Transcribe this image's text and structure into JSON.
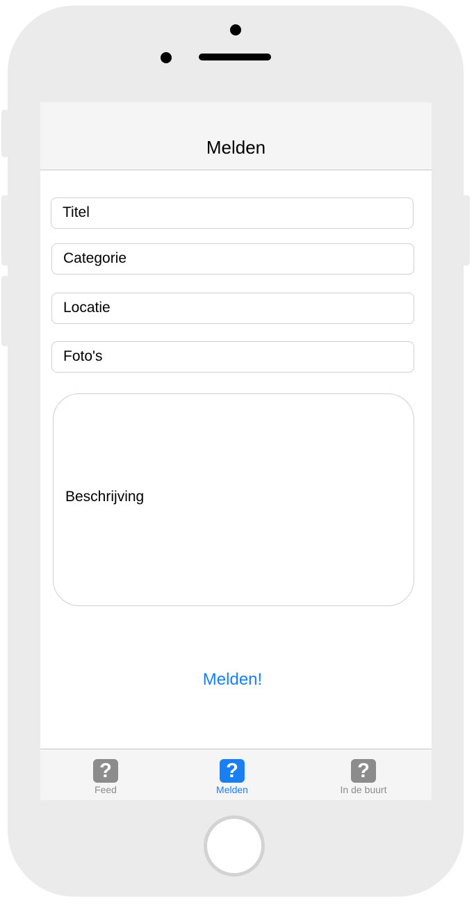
{
  "navbar": {
    "title": "Melden"
  },
  "form": {
    "fields": [
      {
        "placeholder": "Titel"
      },
      {
        "placeholder": "Categorie"
      },
      {
        "placeholder": "Locatie"
      },
      {
        "placeholder": "Foto's"
      }
    ],
    "description_placeholder": "Beschrijving",
    "submit_label": "Melden!"
  },
  "tabbar": {
    "tabs": [
      {
        "label": "Feed",
        "icon": "question-icon",
        "glyph": "?",
        "active": false
      },
      {
        "label": "Melden",
        "icon": "question-icon",
        "glyph": "?",
        "active": true
      },
      {
        "label": "In de buurt",
        "icon": "question-icon",
        "glyph": "?",
        "active": false
      }
    ]
  },
  "colors": {
    "accent": "#1a7ff0",
    "inactive": "#8c8c8c",
    "device_frame": "#ebebeb",
    "bar_background": "#f5f5f5"
  }
}
